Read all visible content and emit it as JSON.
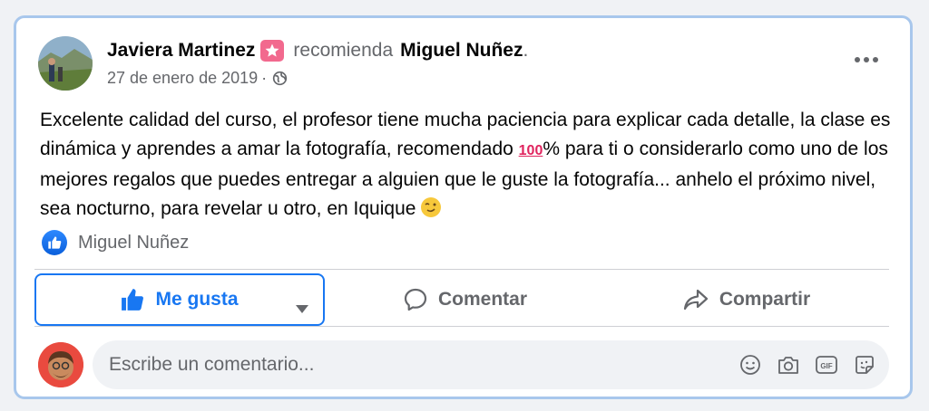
{
  "post": {
    "author": "Javiera Martinez",
    "action_text": "recomienda",
    "recommended_name": "Miguel Nuñez",
    "recommended_suffix": ".",
    "date": "27 de enero de 2019",
    "date_separator": "·",
    "privacy_icon": "globe-icon",
    "text_before_emoji": "Excelente calidad del curso, el profesor tiene mucha paciencia para explicar cada detalle, la clase es dinámica y aprendes a amar la fotografía, recomendado ",
    "emoji_100": "100",
    "text_after_emoji": "% para ti o considerarlo como uno de los mejores regalos que puedes entregar a alguien que le guste la fotografía... anhelo el próximo nivel, sea nocturno, para revelar u otro, en Iquique "
  },
  "likes": {
    "names": "Miguel Nuñez"
  },
  "actions": {
    "like_label": "Me gusta",
    "comment_label": "Comentar",
    "share_label": "Compartir"
  },
  "comment": {
    "placeholder": "Escribe un comentario..."
  },
  "colors": {
    "accent": "#1877f2",
    "card_border": "#a8c7ec",
    "muted_text": "#65676b",
    "badge": "#f2698e"
  }
}
